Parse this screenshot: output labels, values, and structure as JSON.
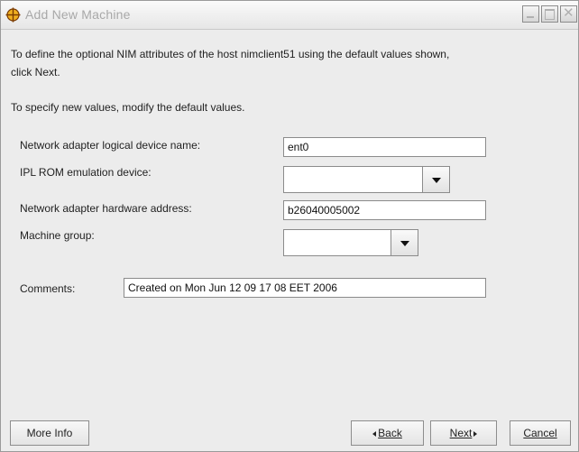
{
  "window": {
    "title": "Add New Machine"
  },
  "intro": {
    "line1": "To define the optional NIM attributes of the host nimclient51 using the default values shown,",
    "line2": "click Next.",
    "line3": "To specify new values, modify the default values."
  },
  "form": {
    "adapter_name_label": "Network adapter logical device name:",
    "adapter_name_value": "ent0",
    "ipl_rom_label": "IPL ROM emulation device:",
    "ipl_rom_value": "",
    "hw_address_label": "Network adapter hardware address:",
    "hw_address_value": "b26040005002",
    "group_label": "Machine group:",
    "group_value": "",
    "comments_label": "Comments:",
    "comments_value": "Created on Mon Jun 12 09 17 08 EET 2006"
  },
  "buttons": {
    "more_info": "More Info",
    "back": "Back",
    "next": "Next",
    "cancel": "Cancel"
  },
  "icons": {
    "app": "crosshair-icon",
    "minimize": "minimize-icon",
    "maximize": "maximize-icon",
    "close": "close-icon",
    "combo_arrow": "chevron-down-icon"
  }
}
